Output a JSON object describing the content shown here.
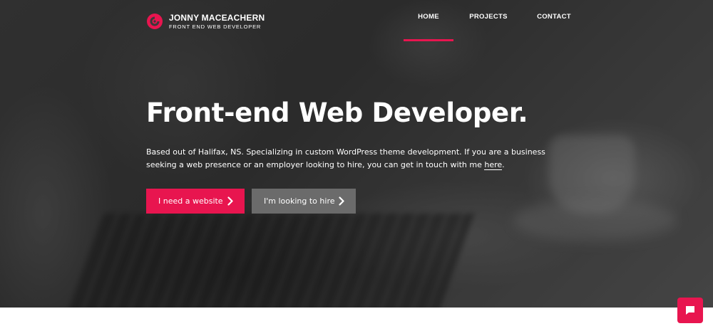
{
  "brand": {
    "name": "JONNY MACEACHERN",
    "tagline": "FRONT END WEB DEVELOPER"
  },
  "nav": {
    "items": [
      {
        "label": "HOME",
        "active": true
      },
      {
        "label": "PROJECTS",
        "active": false
      },
      {
        "label": "CONTACT",
        "active": false
      }
    ]
  },
  "hero": {
    "headline": "Front-end Web Developer.",
    "intro_text": "Based out of Halifax, NS. Specializing in custom WordPress theme development. If you are a business seeking a web presence or an employer looking to hire, you can get in touch with me ",
    "intro_link": "here",
    "intro_end": ".",
    "primary_button": "I need a website",
    "secondary_button": "I'm looking to hire"
  },
  "icons": {
    "logo": "spiral-logo-icon",
    "button_arrow": "chevron-right-icon",
    "chat": "chat-bubble-icon"
  },
  "colors": {
    "accent": "#e8154f",
    "secondary_button": "#6b6b6b",
    "text": "#ffffff"
  }
}
